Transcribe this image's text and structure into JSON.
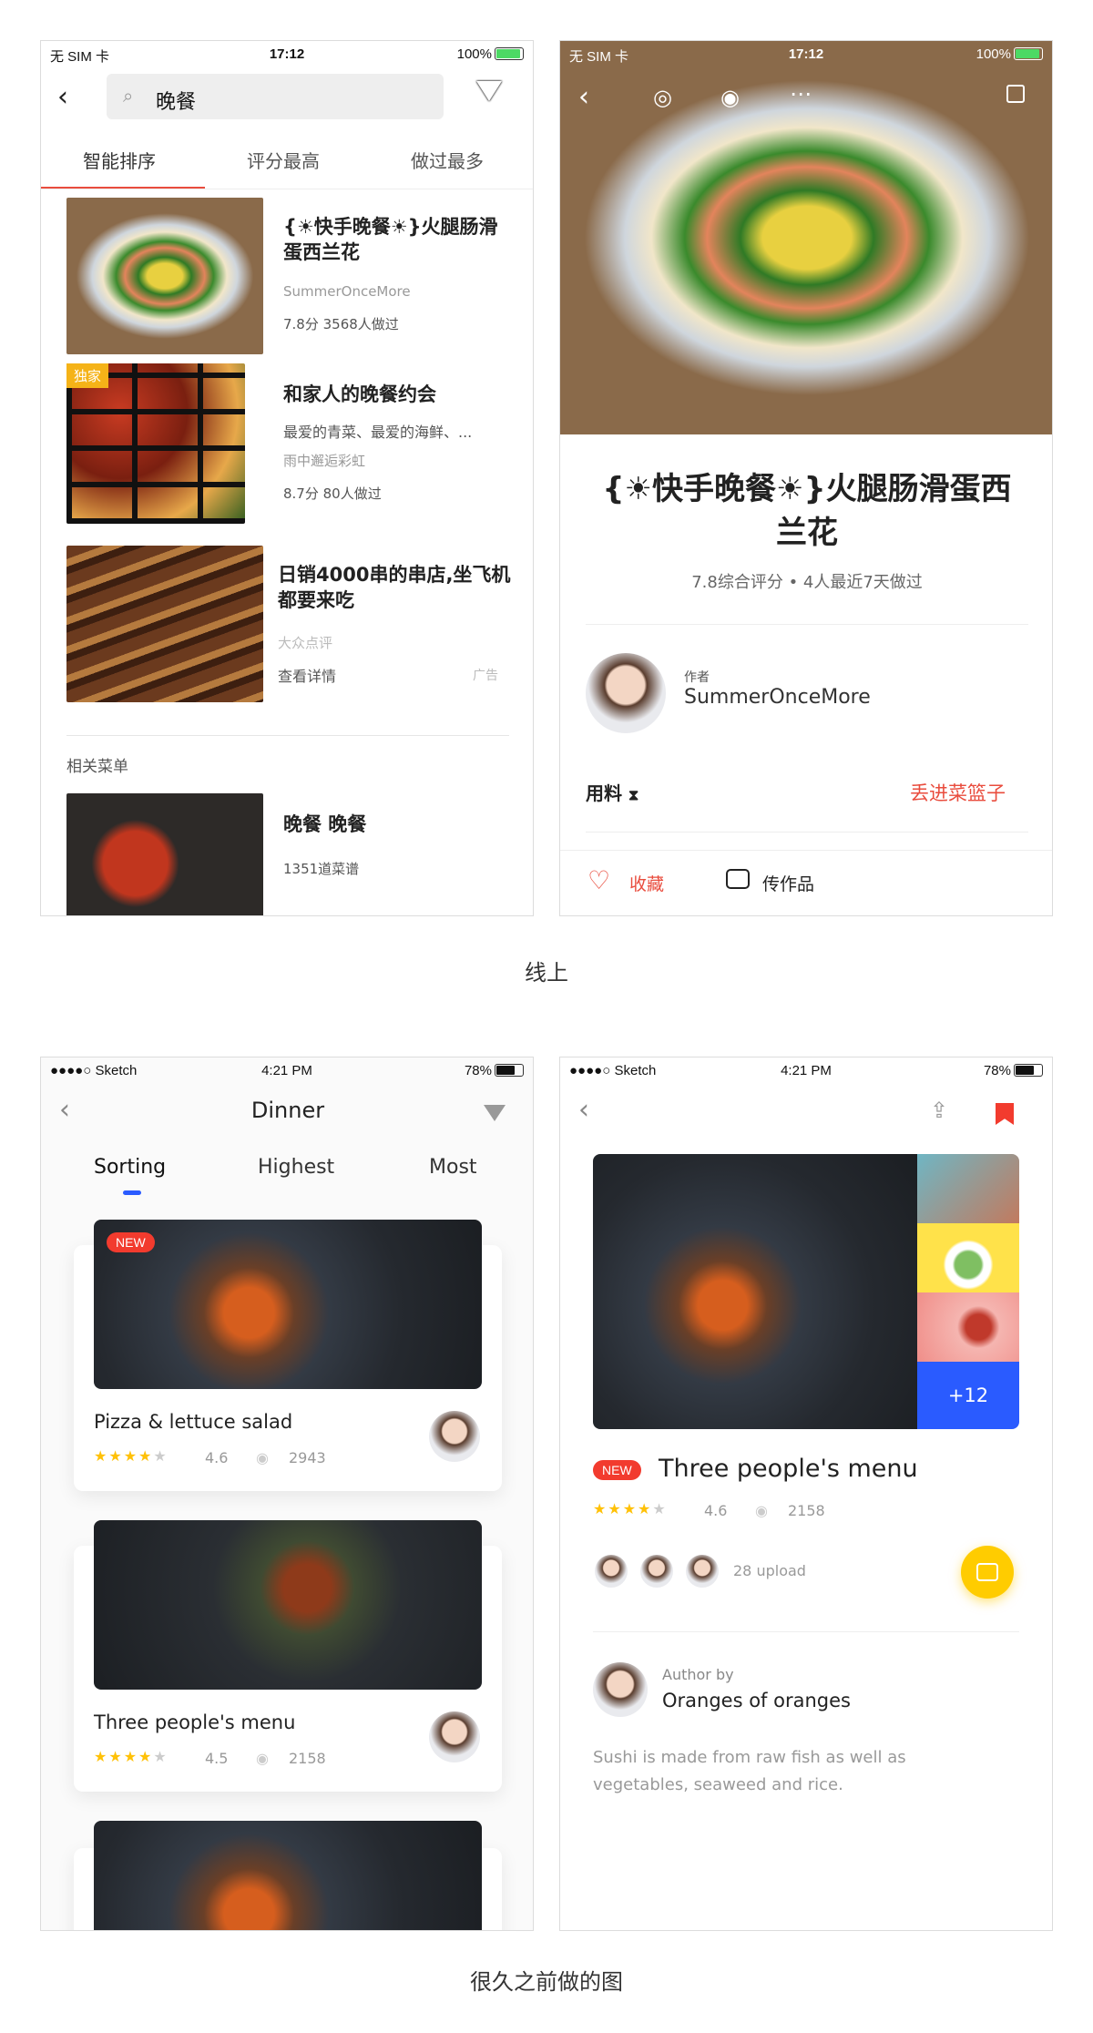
{
  "screens": {
    "online_list": {
      "status": {
        "carrier": "无 SIM 卡",
        "time": "17:12",
        "battery": "100%"
      },
      "search_value": "晚餐",
      "tabs": [
        "智能排序",
        "评分最高",
        "做过最多"
      ],
      "items": [
        {
          "title": "{☀快手晚餐☀}火腿肠滑蛋西兰花",
          "author": "SummerOnceMore",
          "meta": "7.8分 3568人做过"
        },
        {
          "badge": "独家",
          "title": "和家人的晚餐约会",
          "desc": "最爱的青菜、最爱的海鲜、...",
          "author": "雨中邂逅彩虹",
          "meta": "8.7分 80人做过"
        },
        {
          "title": "日销4000串的串店,坐飞机都要来吃",
          "source": "大众点评",
          "link": "查看详情",
          "ad": "广告"
        }
      ],
      "related_title": "相关菜单",
      "related": {
        "title": "晚餐 晚餐",
        "meta": "1351道菜谱"
      }
    },
    "online_detail": {
      "status": {
        "carrier": "无 SIM 卡",
        "time": "17:12",
        "battery": "100%"
      },
      "title": "{☀快手晚餐☀}火腿肠滑蛋西兰花",
      "rating": "7.8综合评分",
      "recent": "4人最近7天做过",
      "author_label": "作者",
      "author": "SummerOnceMore",
      "ingredients": "用料",
      "basket": "丢进菜篮子",
      "fav": "收藏",
      "upload": "传作品"
    },
    "old_list": {
      "status": {
        "carrier": "●●●●○ Sketch",
        "time": "4:21 PM",
        "battery": "78%"
      },
      "title": "Dinner",
      "tabs": [
        "Sorting",
        "Highest",
        "Most"
      ],
      "cards": [
        {
          "badge": "NEW",
          "title": "Pizza & lettuce salad",
          "rating": "4.6",
          "views": "2943"
        },
        {
          "title": "Three people's menu",
          "rating": "4.5",
          "views": "2158"
        }
      ]
    },
    "old_detail": {
      "status": {
        "carrier": "●●●●○ Sketch",
        "time": "4:21 PM",
        "battery": "78%"
      },
      "more": "+12",
      "badge": "NEW",
      "title": "Three people's menu",
      "rating": "4.6",
      "views": "2158",
      "upload": "28 upload",
      "author_label": "Author by",
      "author": "Oranges of oranges",
      "desc": "Sushi is made from raw fish as well as vegetables, seaweed and rice."
    }
  },
  "captions": {
    "online": "线上",
    "old": "很久之前做的图"
  },
  "colors": {
    "accent_red": "#e94c3d",
    "accent_blue": "#2a5bff",
    "star": "#ffc107",
    "camera": "#ffcc00"
  }
}
